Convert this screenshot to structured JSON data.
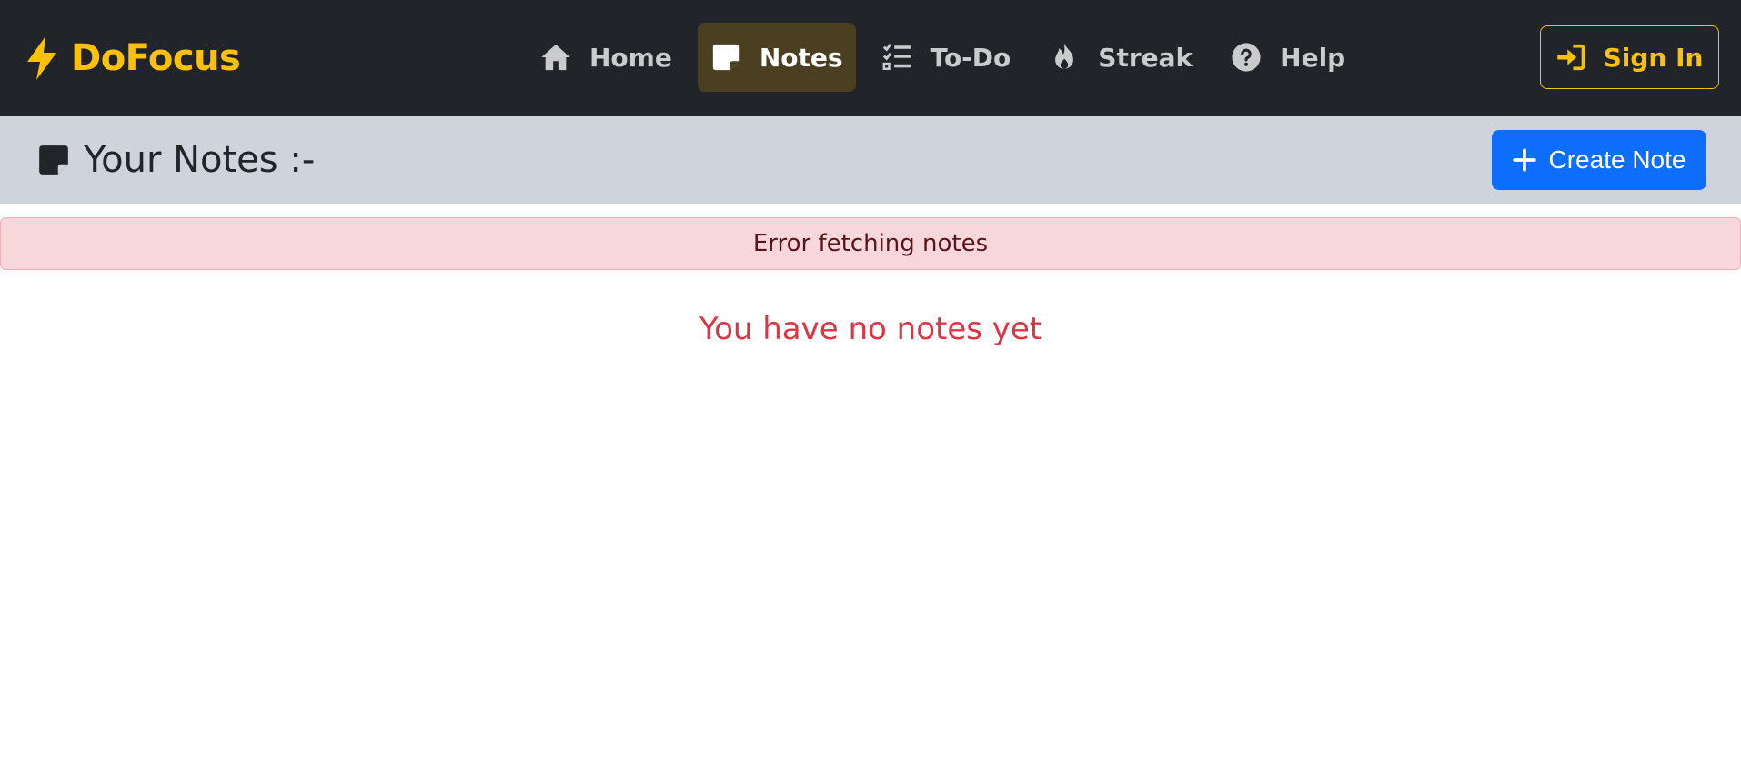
{
  "navbar": {
    "brand": "DoFocus",
    "links": [
      {
        "label": "Home",
        "icon": "home-icon"
      },
      {
        "label": "Notes",
        "icon": "sticky-note-icon",
        "active": true
      },
      {
        "label": "To-Do",
        "icon": "list-check-icon"
      },
      {
        "label": "Streak",
        "icon": "fire-icon"
      },
      {
        "label": "Help",
        "icon": "question-circle-icon"
      }
    ],
    "signin_label": "Sign In"
  },
  "header": {
    "title": "Your Notes :-",
    "create_label": "Create Note"
  },
  "alert": {
    "message": "Error fetching notes"
  },
  "empty_message": "You have no notes yet",
  "colors": {
    "navbar_bg": "#212529",
    "brand": "#ffc107",
    "active_nav_bg": "#4a3f21",
    "header_bg": "#cfd4dc",
    "primary": "#0d6efd",
    "alert_bg": "#f8d7da",
    "alert_text": "#58151c",
    "danger": "#dc3545"
  }
}
